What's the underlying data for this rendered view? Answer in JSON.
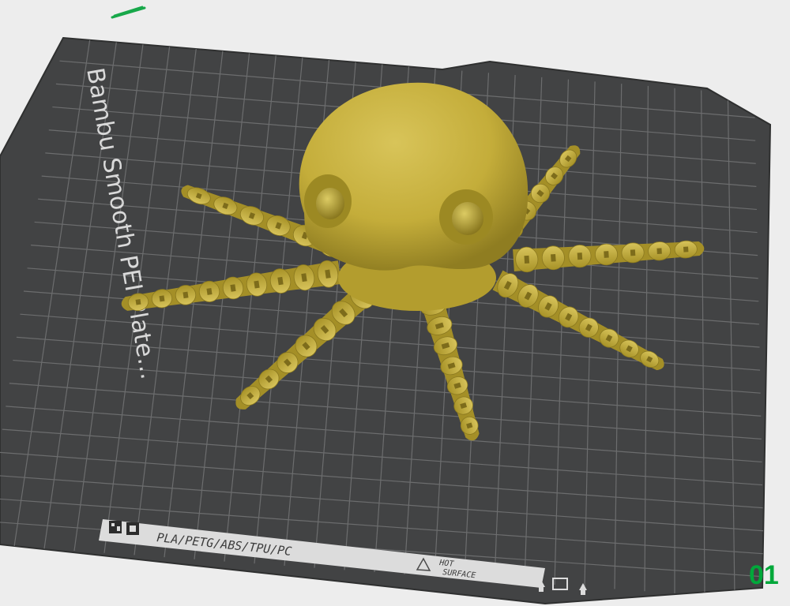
{
  "viewport": {
    "plate_name": "Bambu Smooth PEI Plate",
    "plate_name_suffix": "...",
    "material_strip": "PLA/PETG/ABS/TPU/PC",
    "hot_surface_line1": "HOT",
    "hot_surface_line2": "SURFACE",
    "plate_number": "01",
    "model_name": "octopus",
    "colors": {
      "background": "#ededed",
      "plate": "#424344",
      "grid": "#7a7b7c",
      "model": "#c8b23e",
      "accent_green": "#00a83a"
    },
    "icons": [
      "edit-icon",
      "qr-code-icon",
      "warning-icon",
      "plate-orientation-icons"
    ]
  }
}
